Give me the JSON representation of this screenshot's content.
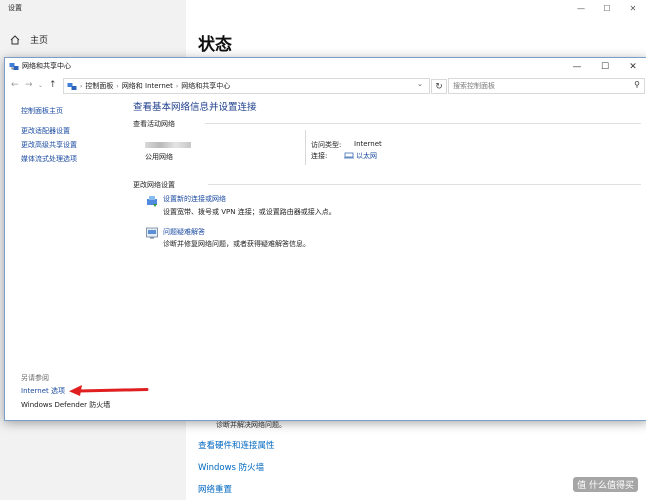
{
  "settings": {
    "title": "设置",
    "home_label": "主页",
    "page_heading": "状态",
    "behind_text": "诊断并解决网络问题。",
    "links": [
      "查看硬件和连接属性",
      "Windows 防火墙",
      "网络重置"
    ]
  },
  "net_window": {
    "title": "网络和共享中心",
    "breadcrumb": [
      "控制面板",
      "网络和 Internet",
      "网络和共享中心"
    ],
    "search_placeholder": "搜索控制面板",
    "left_panel": {
      "home": "控制面板主页",
      "items": [
        "更改适配器设置",
        "更改高级共享设置",
        "媒体流式处理选项"
      ],
      "see_also_label": "另请参阅",
      "see_also_items": [
        "Internet 选项",
        "Windows Defender 防火墙"
      ]
    },
    "main_title": "查看基本网络信息并设置连接",
    "active_networks_label": "查看活动网络",
    "network": {
      "type": "公用网络",
      "access_type_label": "访问类型:",
      "access_type_value": "Internet",
      "connection_label": "连接:",
      "connection_value": "以太网"
    },
    "change_settings_label": "更改网络设置",
    "tasks": [
      {
        "link": "设置新的连接或网络",
        "desc": "设置宽带、拨号或 VPN 连接；或设置路由器或接入点。"
      },
      {
        "link": "问题疑难解答",
        "desc": "诊断并修复网络问题，或者获得疑难解答信息。"
      }
    ]
  },
  "watermark": "值 什么值得买",
  "colors": {
    "link": "#1a4aa0",
    "title_blue": "#1e3e8c",
    "arrow": "#e02020"
  }
}
